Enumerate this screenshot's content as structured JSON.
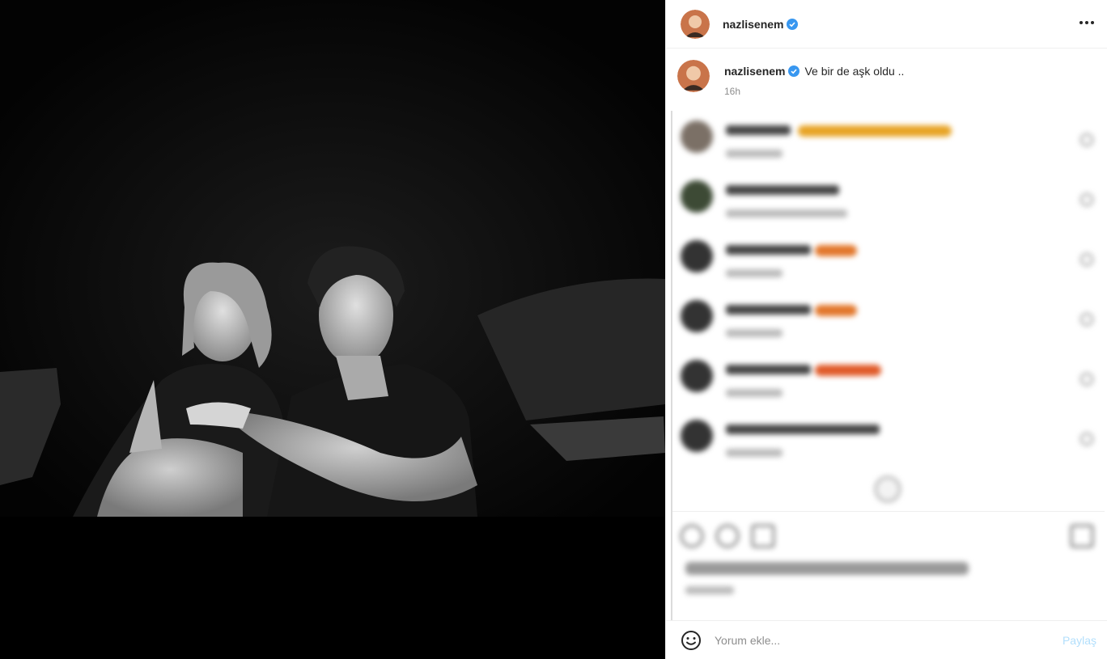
{
  "post": {
    "username": "nazlisenem",
    "caption": "Ve bir de aşk oldu ..",
    "time": "16h"
  },
  "comment_form": {
    "placeholder": "Yorum ekle...",
    "submit_label": "Paylaş"
  },
  "colors": {
    "verified": "#3897f0",
    "accent_disabled": "#b2dffc"
  },
  "icons": {
    "more": "more-options-icon",
    "verified": "verified-badge-icon",
    "emoji": "emoji-smile-icon"
  }
}
